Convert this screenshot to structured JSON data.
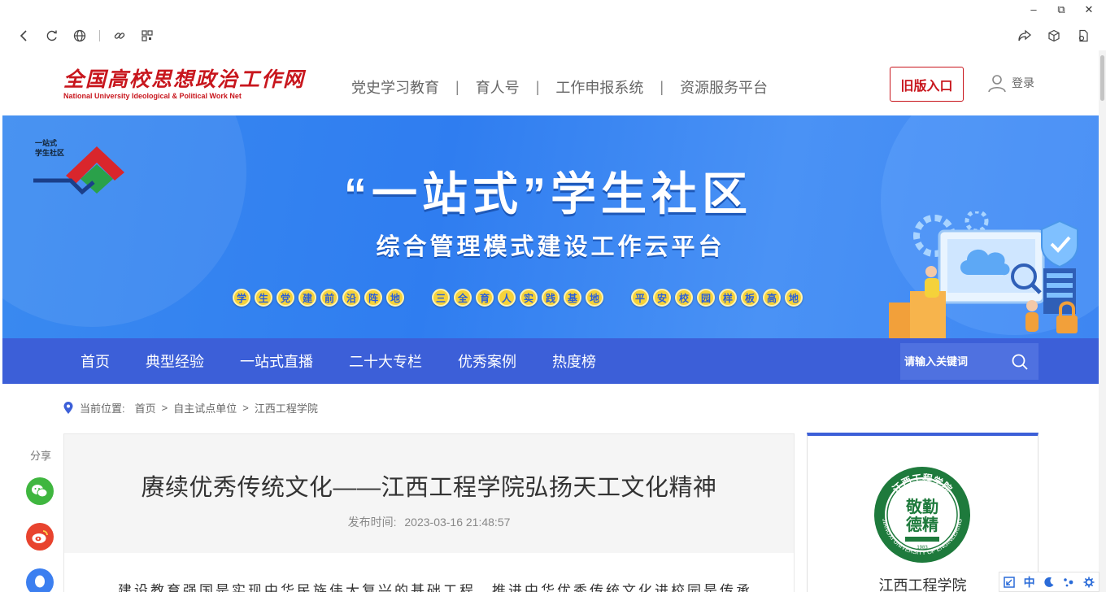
{
  "window": {
    "minimize": "–",
    "restore": "⧉",
    "close": "✕"
  },
  "browser": {
    "back": "‹",
    "reload": "↻"
  },
  "header": {
    "logo_cn": "全国高校思想政治工作网",
    "logo_en": "National University Ideological & Political Work Net",
    "nav": [
      "党史学习教育",
      "育人号",
      "工作申报系统",
      "资源服务平台"
    ],
    "nav_sep": "|",
    "old_version": "旧版入口",
    "login": "登录"
  },
  "banner": {
    "badge_line1": "一站式",
    "badge_line2": "学生社区",
    "title": "“一站式”学生社区",
    "subtitle": "综合管理模式建设工作云平台",
    "pill_groups": [
      [
        "学",
        "生",
        "党",
        "建",
        "前",
        "沿",
        "阵",
        "地"
      ],
      [
        "三",
        "全",
        "育",
        "人",
        "实",
        "践",
        "基",
        "地"
      ],
      [
        "平",
        "安",
        "校",
        "园",
        "样",
        "板",
        "高",
        "地"
      ]
    ]
  },
  "mainnav": {
    "items": [
      "首页",
      "典型经验",
      "一站式直播",
      "二十大专栏",
      "优秀案例",
      "热度榜"
    ],
    "search_placeholder": "请输入关键词"
  },
  "breadcrumb": {
    "label": "当前位置:",
    "items": [
      "首页",
      "自主试点单位",
      "江西工程学院"
    ],
    "sep": ">"
  },
  "share": {
    "label": "分享"
  },
  "article": {
    "title": "赓续优秀传统文化——江西工程学院弘扬天工文化精神",
    "publish_label": "发布时间:",
    "publish_time": "2023-03-16 21:48:57",
    "body_first_line": "建设教育强国是实现中华民族伟大复兴的基础工程，推进中华优秀传统文化进校园是传承中"
  },
  "sidebar": {
    "school_name": "江西工程学院",
    "emblem_top": "江西工程学院",
    "emblem_center_1": "敬勤",
    "emblem_center_2": "德精",
    "emblem_bottom": "JIANGXI UNIVERSITY OF ENGINEERING",
    "emblem_year": "1983"
  },
  "tools": {
    "lang": "中"
  },
  "colors": {
    "brand_red": "#c8161d",
    "nav_blue": "#3c5fd8",
    "banner_blue": "#3a8af0",
    "emblem_green": "#1e7a3c"
  }
}
